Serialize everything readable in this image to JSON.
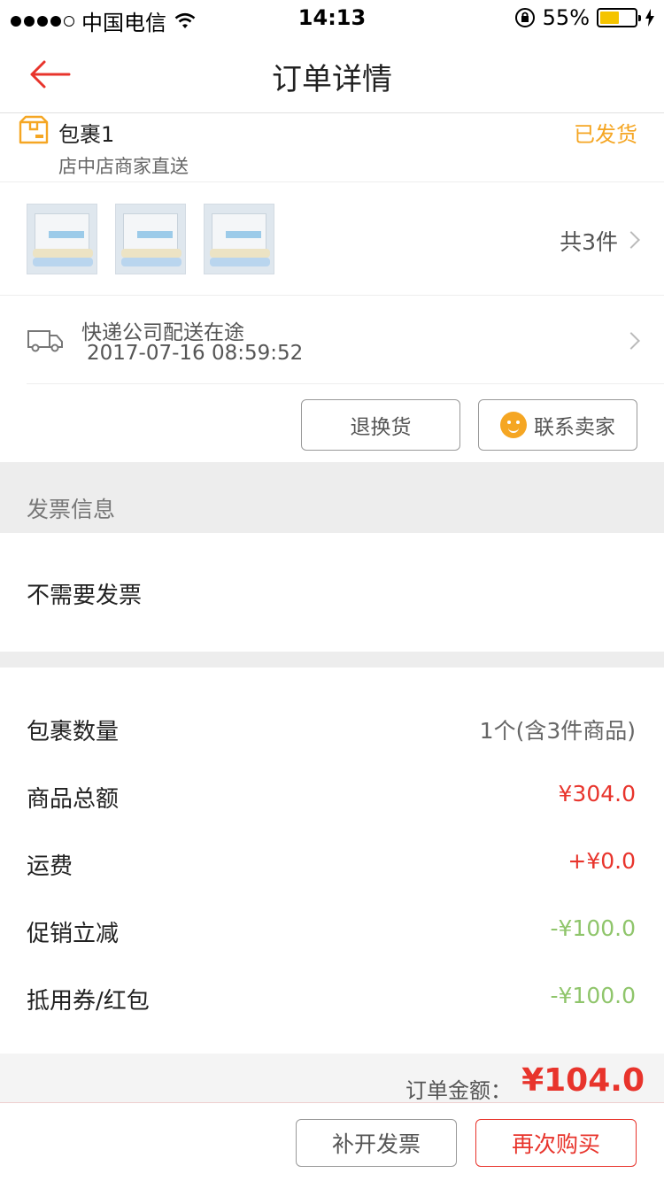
{
  "status_bar": {
    "carrier": "中国电信",
    "time": "14:13",
    "battery": "55%",
    "battery_level": 0.55
  },
  "nav": {
    "title": "订单详情"
  },
  "package": {
    "name": "包裹1",
    "subtitle": "店中店商家直送",
    "status": "已发货",
    "item_count": "共3件"
  },
  "logistics": {
    "status": "快递公司配送在途",
    "time": "2017-07-16 08:59:52"
  },
  "actions": {
    "return_label": "退换货",
    "contact_label": "联系卖家"
  },
  "invoice": {
    "section_title": "发票信息",
    "value": "不需要发票"
  },
  "summary": {
    "rows": [
      {
        "key": "包裹数量",
        "value": "1个(含3件商品)",
        "color": "#666666"
      },
      {
        "key": "商品总额",
        "value": "¥304.0",
        "color": "#e8342c"
      },
      {
        "key": "运费",
        "value": "+¥0.0",
        "color": "#e8342c"
      },
      {
        "key": "促销立减",
        "value": "-¥100.0",
        "color": "#8fc56b"
      },
      {
        "key": "抵用券/红包",
        "value": "-¥100.0",
        "color": "#8fc56b"
      }
    ],
    "total_label": "订单金额：",
    "total_amount": "¥104.0"
  },
  "bottom_bar": {
    "invoice_button": "补开发票",
    "rebuy_button": "再次购买"
  },
  "colors": {
    "accent_red": "#e8342c",
    "status_orange": "#f5a623",
    "discount_green": "#8fc56b"
  }
}
